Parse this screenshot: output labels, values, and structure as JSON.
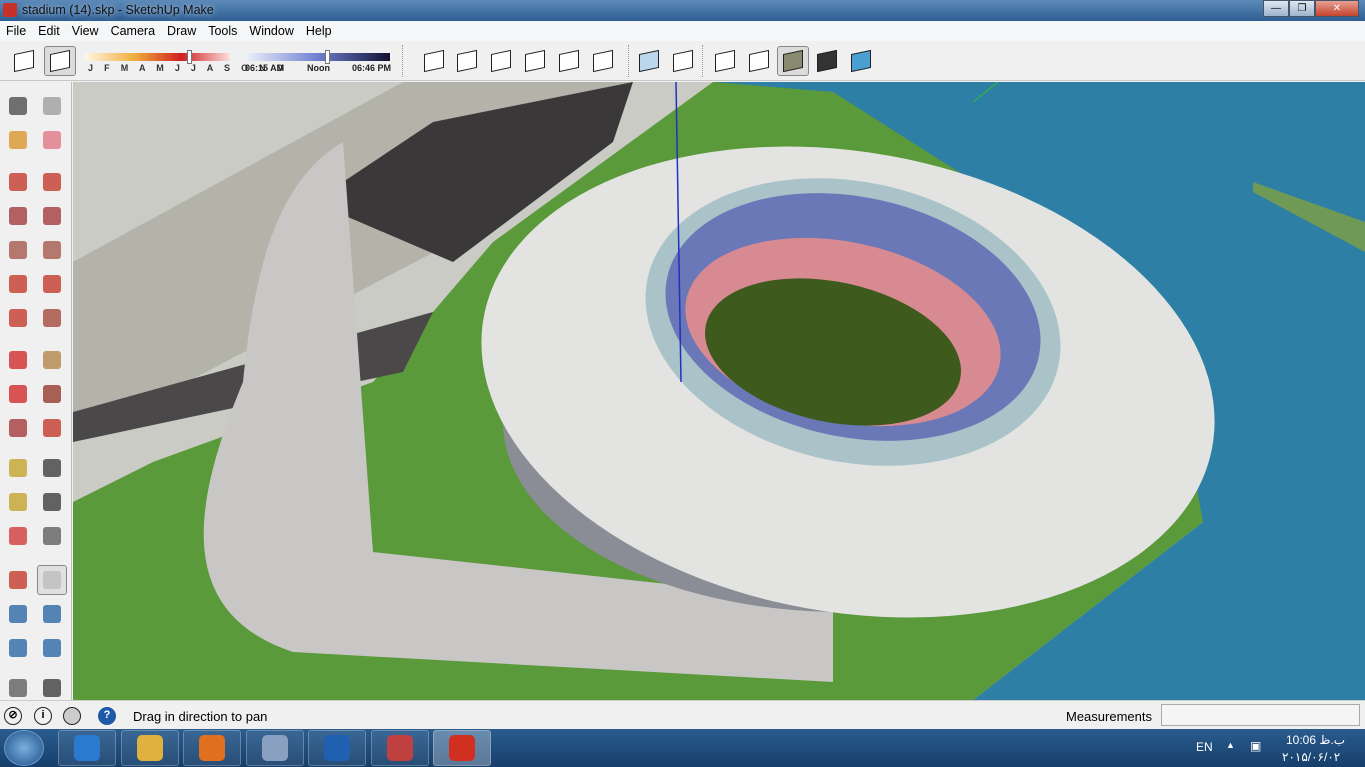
{
  "window": {
    "title": "stadium (14).skp - SketchUp Make",
    "minimize": "—",
    "maximize": "❐",
    "close": "✕"
  },
  "menu": [
    "File",
    "Edit",
    "View",
    "Camera",
    "Draw",
    "Tools",
    "Window",
    "Help"
  ],
  "shadow": {
    "months": "J F M A M J J A S O N D",
    "time_start": "06:15 AM",
    "time_mid": "Noon",
    "time_end": "06:46 PM",
    "month_position": 0.7,
    "time_position": 0.55
  },
  "toolbar_icons": [
    "model-info-icon",
    "shadows-toggle-icon",
    "iso-view-icon",
    "top-view-icon",
    "front-view-icon",
    "right-view-icon",
    "back-view-icon",
    "left-view-icon",
    "xray-icon",
    "back-edges-icon",
    "wireframe-icon",
    "hidden-line-icon",
    "shaded-icon",
    "shaded-textures-icon",
    "monochrome-icon"
  ],
  "palette_icons": [
    "select-icon",
    "make-component-icon",
    "paint-bucket-icon",
    "eraser-icon",
    "pencil-icon",
    "freehand-icon",
    "rectangle-icon",
    "rotated-rectangle-icon",
    "circle-icon",
    "polygon-icon",
    "arc-icon",
    "two-point-arc-icon",
    "three-point-arc-icon",
    "pie-icon",
    "move-icon",
    "push-pull-icon",
    "rotate-icon",
    "follow-me-icon",
    "scale-icon",
    "offset-icon",
    "tape-measure-icon",
    "dimension-icon",
    "protractor-icon",
    "text-icon",
    "axes-icon",
    "3d-text-icon",
    "orbit-icon",
    "pan-icon",
    "zoom-icon",
    "zoom-window-icon",
    "zoom-extents-icon",
    "previous-view-icon",
    "position-camera-icon",
    "look-around-icon"
  ],
  "status": {
    "message": "Drag in direction to pan",
    "measurements_label": "Measurements",
    "measurements_value": ""
  },
  "taskbar": {
    "apps": [
      "internet-explorer",
      "file-explorer",
      "media-player",
      "remote-desktop",
      "google-earth",
      "snipping-tool",
      "sketchup"
    ],
    "lang": "EN",
    "time": "10:06 ب.ظ",
    "date": "۲۰۱۵/۰۶/۰۲"
  }
}
